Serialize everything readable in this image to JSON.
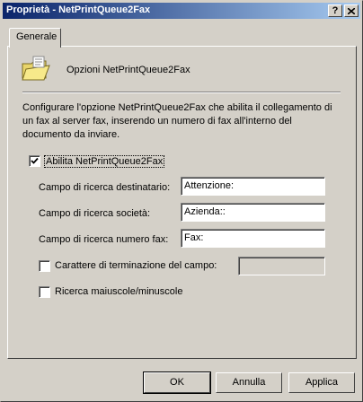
{
  "window": {
    "title": "Proprietà - NetPrintQueue2Fax",
    "help_btn": "?",
    "close_btn": "X"
  },
  "tabs": [
    {
      "label": "Generale"
    }
  ],
  "header": {
    "title": "Opzioni NetPrintQueue2Fax"
  },
  "description": "Configurare l'opzione NetPrintQueue2Fax che abilita il collegamento di un fax al server fax, inserendo un numero di fax all'interno del documento da inviare.",
  "enable": {
    "label": "Abilita NetPrintQueue2Fax",
    "checked": true
  },
  "fields": [
    {
      "label": "Campo di ricerca destinatario:",
      "value": "Attenzione:"
    },
    {
      "label": "Campo di ricerca società:",
      "value": "Azienda::"
    },
    {
      "label": "Campo di ricerca numero fax:",
      "value": "Fax:"
    }
  ],
  "terminator": {
    "label": "Carattere di terminazione del campo:",
    "checked": false,
    "value": ""
  },
  "casing": {
    "label": "Ricerca maiuscole/minuscole",
    "checked": false
  },
  "buttons": {
    "ok": "OK",
    "cancel": "Annulla",
    "apply": "Applica"
  }
}
